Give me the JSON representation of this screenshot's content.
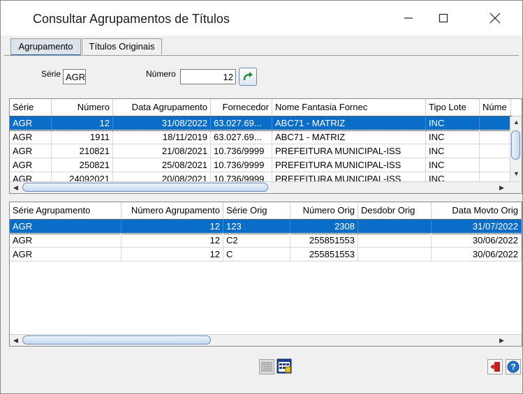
{
  "window": {
    "title": "Consultar Agrupamentos de Títulos",
    "minimize_icon": "minimize-icon",
    "maximize_icon": "maximize-icon",
    "close_icon": "close-icon"
  },
  "tabs": [
    {
      "label": "Agrupamento",
      "active": true
    },
    {
      "label": "Títulos Originais",
      "active": false
    }
  ],
  "filters": {
    "serie_label": "Série",
    "serie_value": "AGR",
    "numero_label": "Número",
    "numero_value": "12",
    "go_icon": "refresh-arrow-icon"
  },
  "grid1": {
    "headers": [
      "Série",
      "Número",
      "Data Agrupamento",
      "Fornecedor",
      "Nome Fantasia Fornec",
      "Tipo Lote",
      "Núme"
    ],
    "rows": [
      [
        "AGR",
        "12",
        "31/08/2022",
        "63.027.69...",
        "ABC71 - MATRIZ",
        "INC",
        ""
      ],
      [
        "AGR",
        "1911",
        "18/11/2019",
        "63.027.69...",
        "ABC71 - MATRIZ",
        "INC",
        ""
      ],
      [
        "AGR",
        "210821",
        "21/08/2021",
        "10.736/9999",
        "PREFEITURA MUNICIPAL-ISS",
        "INC",
        ""
      ],
      [
        "AGR",
        "250821",
        "25/08/2021",
        "10.736/9999",
        "PREFEITURA MUNICIPAL-ISS",
        "INC",
        ""
      ],
      [
        "AGR",
        "24092021",
        "20/08/2021",
        "10.736/9999",
        "PREFEITURA MUNICIPAL-ISS",
        "INC",
        ""
      ]
    ],
    "selected_row": 0
  },
  "grid2": {
    "headers": [
      "Série Agrupamento",
      "Número Agrupamento",
      "Série Orig",
      "Número Orig",
      "Desdobr Orig",
      "Data Movto Orig"
    ],
    "rows": [
      [
        "AGR",
        "12",
        "123",
        "2308",
        "",
        "31/07/2022"
      ],
      [
        "AGR",
        "12",
        "C2",
        "255851553",
        "",
        "30/06/2022"
      ],
      [
        "AGR",
        "12",
        "C",
        "255851553",
        "",
        "30/06/2022"
      ]
    ],
    "selected_row": 0
  },
  "footer": {
    "left_icon": "list-view-icon",
    "right_icon": "calendar-grid-icon",
    "exit_icon": "exit-icon",
    "help_icon": "help-icon",
    "help_glyph": "?"
  },
  "colors": {
    "selection": "#0a6ec8",
    "tab_active": "#dde3ea",
    "window_bg": "#f0f0f0"
  }
}
